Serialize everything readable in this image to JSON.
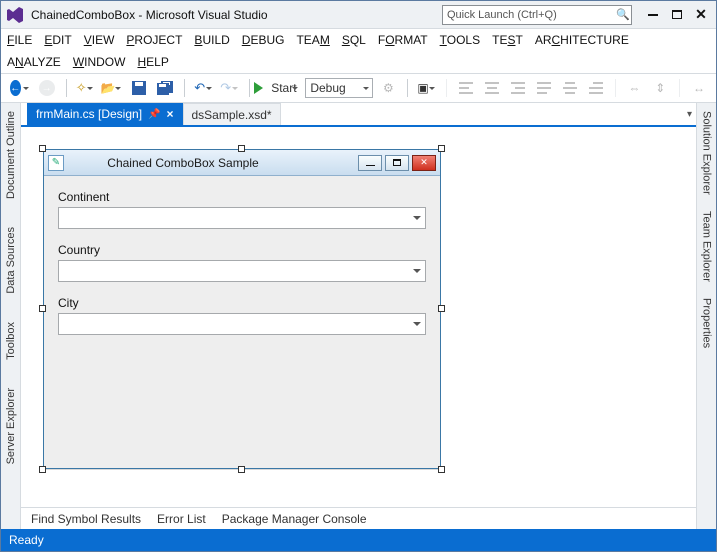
{
  "titlebar": {
    "title": "ChainedComboBox - Microsoft Visual Studio",
    "quickLaunchPlaceholder": "Quick Launch (Ctrl+Q)"
  },
  "menus": {
    "row1": [
      "FILE",
      "EDIT",
      "VIEW",
      "PROJECT",
      "BUILD",
      "DEBUG",
      "TEAM",
      "SQL",
      "FORMAT",
      "TOOLS",
      "TEST",
      "ARCHITECTURE"
    ],
    "row2": [
      "ANALYZE",
      "WINDOW",
      "HELP"
    ]
  },
  "toolbar": {
    "startLabel": "Start",
    "configuration": "Debug"
  },
  "leftRail": [
    "Document Outline",
    "Data Sources",
    "Toolbox",
    "Server Explorer"
  ],
  "rightRail": [
    "Solution Explorer",
    "Team Explorer",
    "Properties"
  ],
  "docTabs": {
    "active": "frmMain.cs [Design]",
    "inactive": "dsSample.xsd*"
  },
  "designerForm": {
    "title": "Chained ComboBox Sample",
    "labels": {
      "continent": "Continent",
      "country": "Country",
      "city": "City"
    }
  },
  "bottomTabs": [
    "Find Symbol Results",
    "Error List",
    "Package Manager Console"
  ],
  "status": "Ready"
}
